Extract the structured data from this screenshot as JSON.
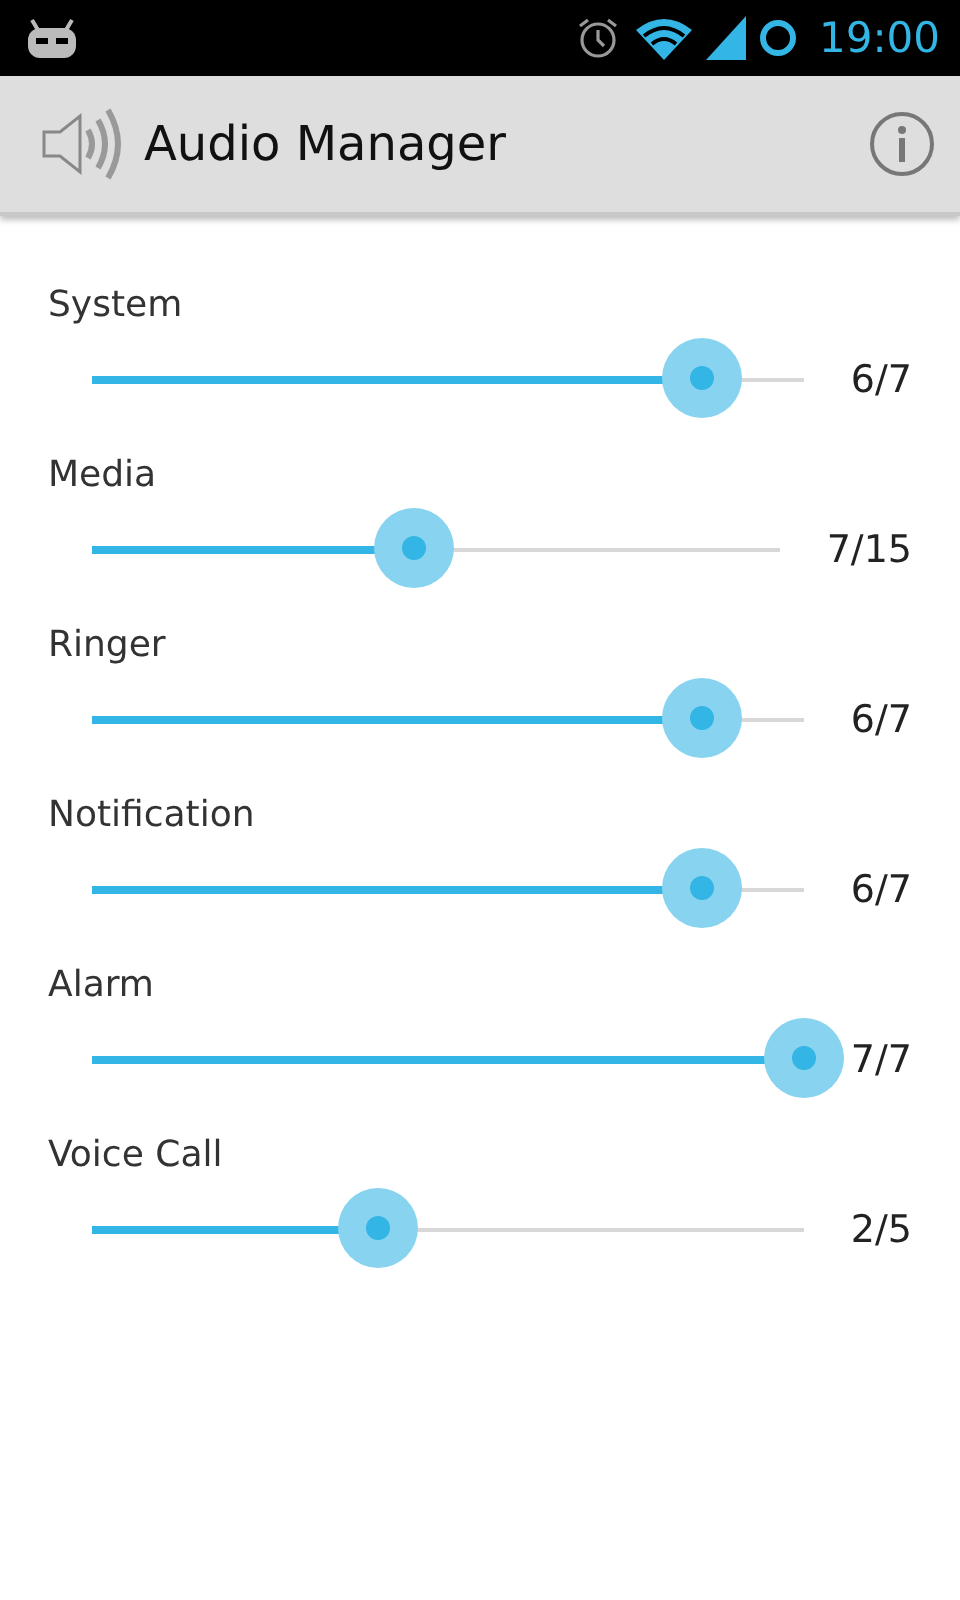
{
  "status_bar": {
    "time": "19:00"
  },
  "app_bar": {
    "title": "Audio Manager"
  },
  "channels": [
    {
      "name": "System",
      "level": 0.857,
      "reading": "6/7"
    },
    {
      "name": "Media",
      "level": 0.467,
      "reading": "7/15"
    },
    {
      "name": "Ringer",
      "level": 0.857,
      "reading": "6/7"
    },
    {
      "name": "Notification",
      "level": 0.857,
      "reading": "6/7"
    },
    {
      "name": "Alarm",
      "level": 1,
      "reading": "7/7"
    },
    {
      "name": "Voice Call",
      "level": 0.4,
      "reading": "2/5"
    }
  ]
}
